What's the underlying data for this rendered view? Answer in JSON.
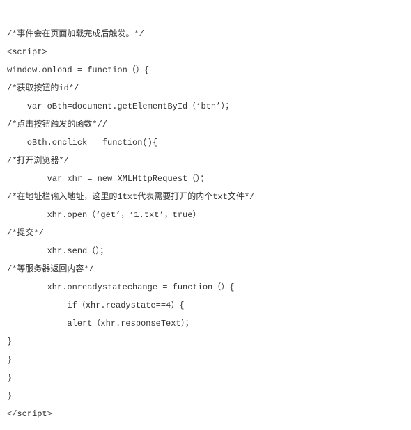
{
  "code": {
    "lines": [
      "/*事件会在页面加载完成后触发。*/",
      "<script>",
      "window.onload = function（）{",
      "/*获取按钮的id*/",
      "    var oBth=document.getElementById（‘btn’）；",
      "/*点击按钮触发的函数*//",
      "    oBth.onclick = function(){",
      "/*打开浏览器*/",
      "        var xhr = new XMLHttpRequest（）；",
      "/*在地址栏输入地址，这里的1txt代表需要打开的内个txt文件*/",
      "        xhr.open（‘get’，‘1.txt’，true）",
      "/*提交*/",
      "        xhr.send（）；",
      "/*等服务器返回内容*/",
      "        xhr.onreadystatechange = function（）{",
      "            if（xhr.readystate==4）{",
      "            alert（xhr.responseText）；",
      "}",
      "}",
      "}",
      "}",
      "</script>"
    ]
  }
}
